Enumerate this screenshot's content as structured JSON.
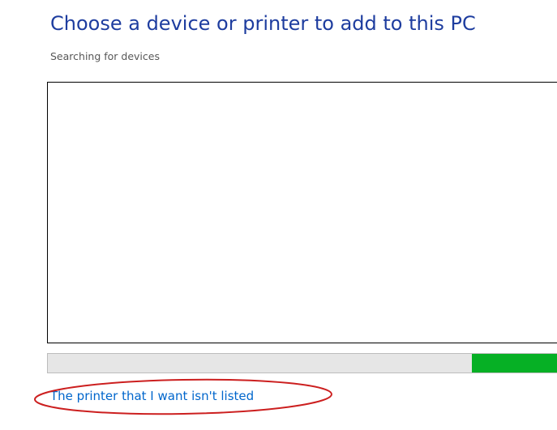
{
  "dialog": {
    "title": "Choose a device or printer to add to this PC",
    "status": "Searching for devices"
  },
  "device_list": {
    "items": []
  },
  "search_progress": {
    "moving_segment_start_fraction": 0.82,
    "moving_segment_end_fraction": 1.0,
    "track_color": "#e6e6e6",
    "fill_color": "#06b025"
  },
  "links": {
    "printer_not_listed": "The printer that I want isn't listed"
  },
  "colors": {
    "title": "#1e3d9f",
    "link": "#0066cc",
    "annotation_ellipse": "#cc1f1f"
  }
}
